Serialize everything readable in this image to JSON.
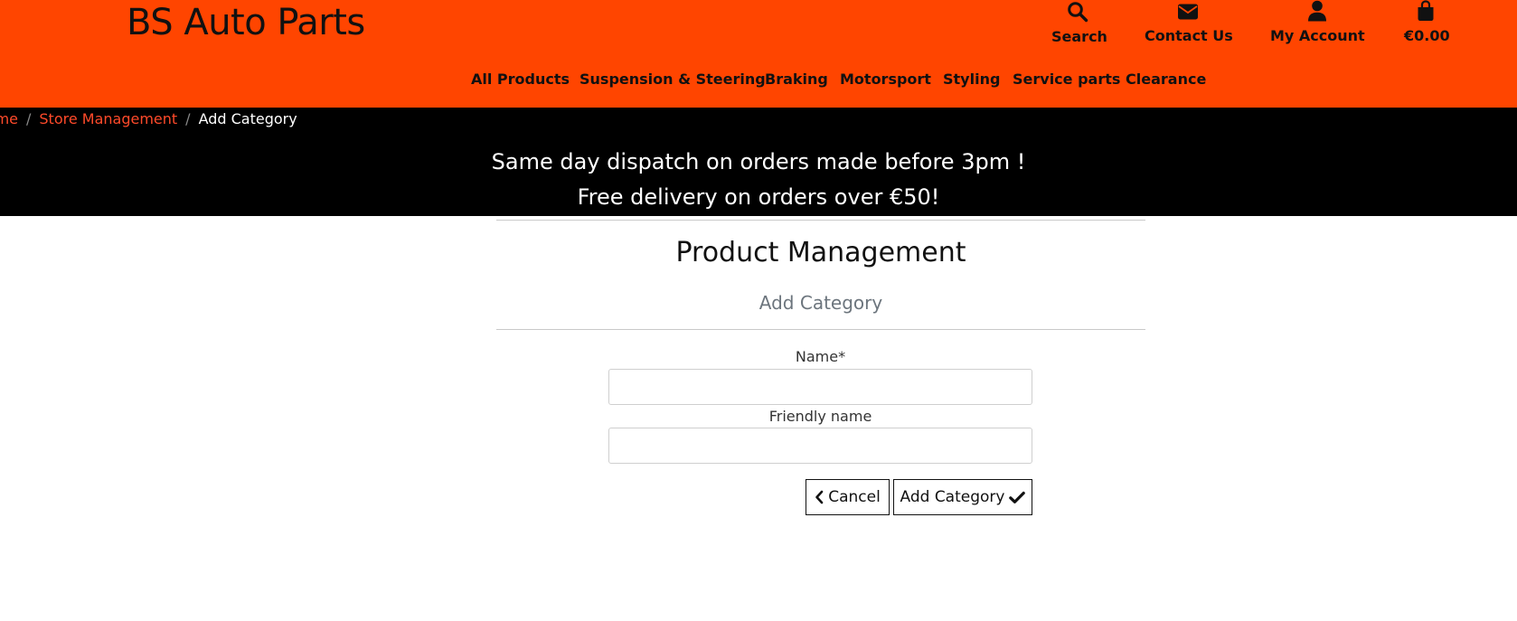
{
  "header": {
    "logo": "BS Auto Parts",
    "icon_nav": [
      {
        "label": "Search",
        "icon": "search-icon"
      },
      {
        "label": "Contact Us",
        "icon": "envelope-icon"
      },
      {
        "label": "My Account",
        "icon": "user-icon"
      },
      {
        "label": "€0.00",
        "icon": "shopping-bag-icon"
      }
    ],
    "main_nav": [
      "All Products",
      "Suspension & Steering",
      "Braking",
      "Motorsport",
      "Styling",
      "Service parts",
      "Clearance"
    ]
  },
  "breadcrumb": {
    "items": [
      "Home",
      "Store Management",
      "Add Category"
    ],
    "separator": "/"
  },
  "banner": {
    "line1": "Same day dispatch on orders made before 3pm !",
    "line2": "Free delivery on orders over €50!"
  },
  "page": {
    "title": "Product Management",
    "subtitle": "Add Category"
  },
  "form": {
    "name_label": "Name*",
    "name_value": "",
    "friendly_label": "Friendly name",
    "friendly_value": "",
    "cancel_label": "Cancel",
    "submit_label": "Add Category"
  },
  "colors": {
    "header_bg": "#ff4500",
    "banner_bg": "#000000",
    "breadcrumb_link": "#ff4a2a",
    "subtitle": "#6c757d"
  }
}
